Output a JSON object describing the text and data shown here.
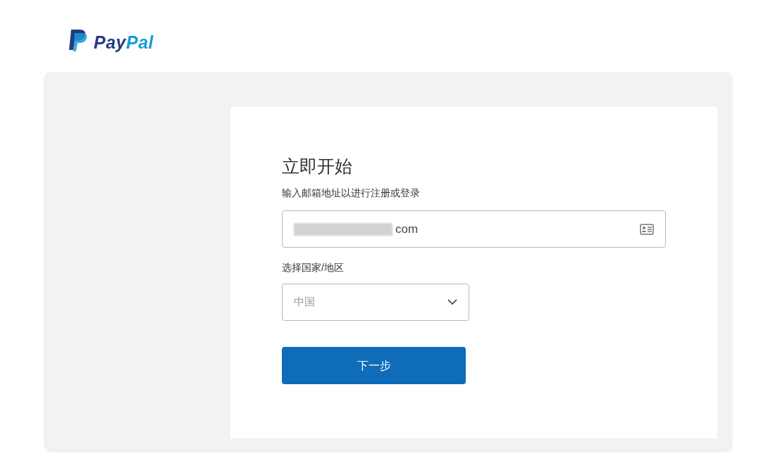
{
  "logo": {
    "text": "PayPal"
  },
  "form": {
    "title": "立即开始",
    "subtitle": "输入邮箱地址以进行注册或登录",
    "email": {
      "value": "com",
      "redacted": true
    },
    "country_label": "选择国家/地区",
    "country": {
      "value": "中国"
    },
    "submit": "下一步"
  }
}
